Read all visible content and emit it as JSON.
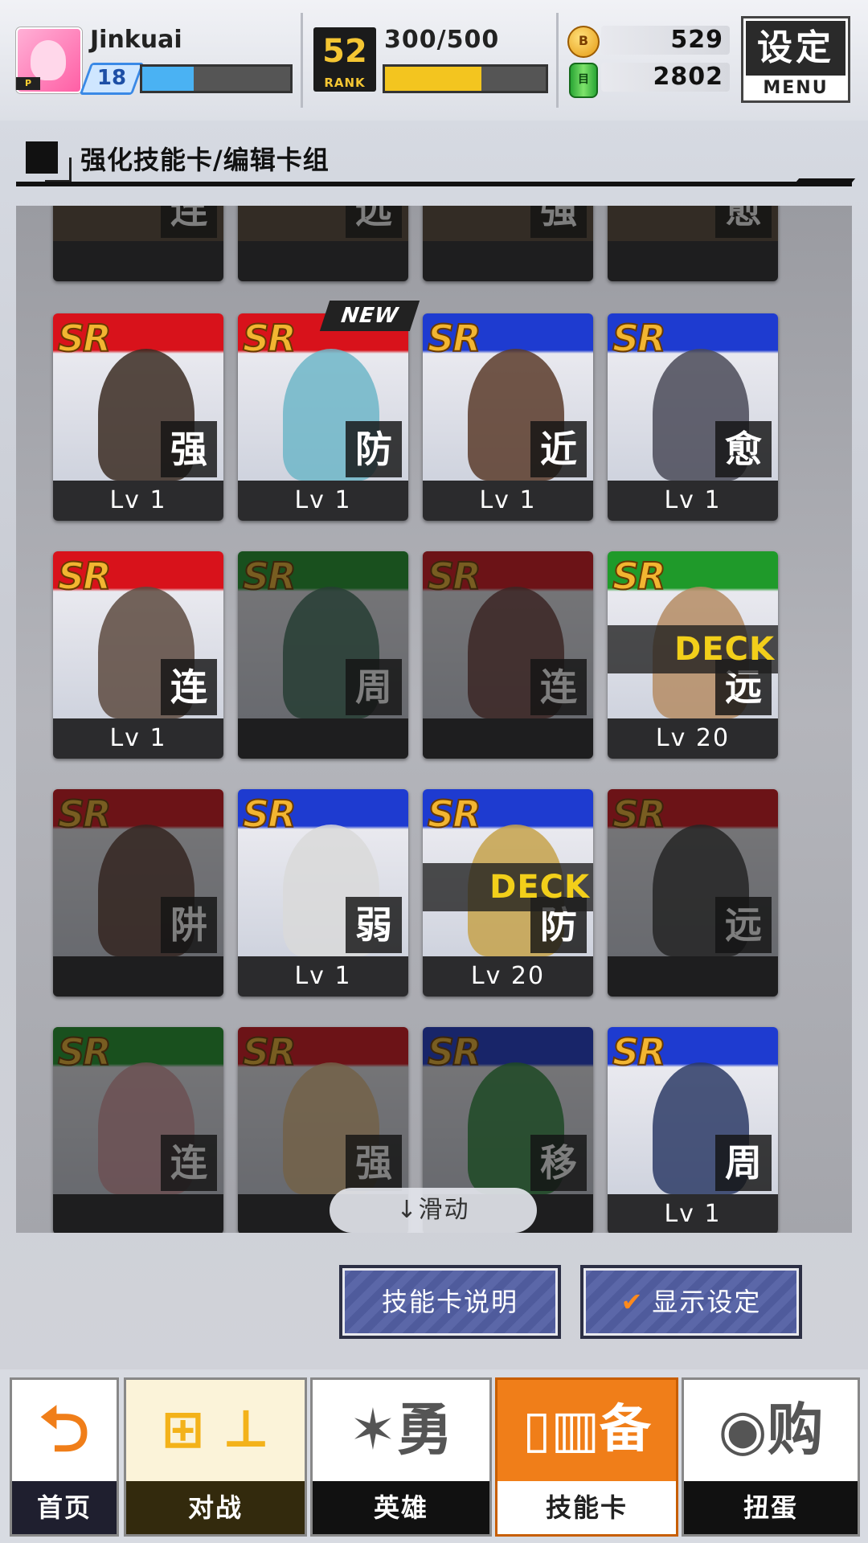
{
  "player": {
    "name": "Jinkuai",
    "level": "18",
    "xp_fraction": 0.35,
    "badge": "P"
  },
  "rank": {
    "value": "52",
    "label": "RANK",
    "exp_text": "300/500",
    "exp_fraction": 0.6
  },
  "currency": {
    "coin_icon": "B",
    "coins": "529",
    "gem_icon": "目",
    "gems": "2802"
  },
  "menu": {
    "label": "设定",
    "sub": "MENU"
  },
  "section": {
    "title": "强化技能卡/编辑卡组"
  },
  "cards_top_partial": [
    {
      "type": "连"
    },
    {
      "type": "远"
    },
    {
      "type": "强"
    },
    {
      "type": "愈"
    }
  ],
  "cards": [
    {
      "rarity": "SR",
      "type": "强",
      "level": "Lv 1",
      "color": "#d8121b",
      "owned": true,
      "deck": "",
      "new": false
    },
    {
      "rarity": "SR",
      "type": "防",
      "level": "Lv 1",
      "color": "#d8121b",
      "owned": true,
      "deck": "",
      "new": true
    },
    {
      "rarity": "SR",
      "type": "近",
      "level": "Lv 1",
      "color": "#1e3bd0",
      "owned": true,
      "deck": "",
      "new": false
    },
    {
      "rarity": "SR",
      "type": "愈",
      "level": "Lv 1",
      "color": "#1e3bd0",
      "owned": true,
      "deck": "",
      "new": false
    },
    {
      "rarity": "SR",
      "type": "连",
      "level": "Lv 1",
      "color": "#d8121b",
      "owned": true,
      "deck": "",
      "new": false
    },
    {
      "rarity": "SR",
      "type": "周",
      "level": "",
      "color": "#1f9a2a",
      "owned": false,
      "deck": "",
      "new": false
    },
    {
      "rarity": "SR",
      "type": "连",
      "level": "",
      "color": "#d8121b",
      "owned": false,
      "deck": "",
      "new": false
    },
    {
      "rarity": "SR",
      "type": "远",
      "level": "Lv 20",
      "color": "#1f9a2a",
      "owned": true,
      "deck": "DECK",
      "new": false
    },
    {
      "rarity": "SR",
      "type": "阱",
      "level": "",
      "color": "#d8121b",
      "owned": false,
      "deck": "",
      "new": false
    },
    {
      "rarity": "SR",
      "type": "弱",
      "level": "Lv 1",
      "color": "#1e3bd0",
      "owned": true,
      "deck": "",
      "new": false
    },
    {
      "rarity": "SR",
      "type": "防",
      "level": "Lv 20",
      "color": "#1e3bd0",
      "owned": true,
      "deck": "DECK",
      "new": false
    },
    {
      "rarity": "SR",
      "type": "远",
      "level": "",
      "color": "#d8121b",
      "owned": false,
      "deck": "",
      "new": false
    },
    {
      "rarity": "SR",
      "type": "连",
      "level": "",
      "color": "#1f9a2a",
      "owned": false,
      "deck": "",
      "new": false
    },
    {
      "rarity": "SR",
      "type": "强",
      "level": "",
      "color": "#d8121b",
      "owned": false,
      "deck": "",
      "new": false
    },
    {
      "rarity": "SR",
      "type": "移",
      "level": "",
      "color": "#1e3bd0",
      "owned": false,
      "deck": "",
      "new": false
    },
    {
      "rarity": "SR",
      "type": "周",
      "level": "Lv 1",
      "color": "#1e3bd0",
      "owned": true,
      "deck": "",
      "new": false
    }
  ],
  "new_tag": "NEW",
  "scroll_hint": "↓滑动",
  "actions": {
    "card_info": "技能卡说明",
    "display_settings": "显示设定",
    "check": "✔"
  },
  "nav": [
    {
      "icon": "⮌",
      "label": "首页"
    },
    {
      "icon": "⊞ ⊥",
      "label": "对战"
    },
    {
      "icon": "✶勇",
      "label": "英雄"
    },
    {
      "icon": "▯▥备",
      "label": "技能卡"
    },
    {
      "icon": "◉购",
      "label": "扭蛋"
    }
  ]
}
